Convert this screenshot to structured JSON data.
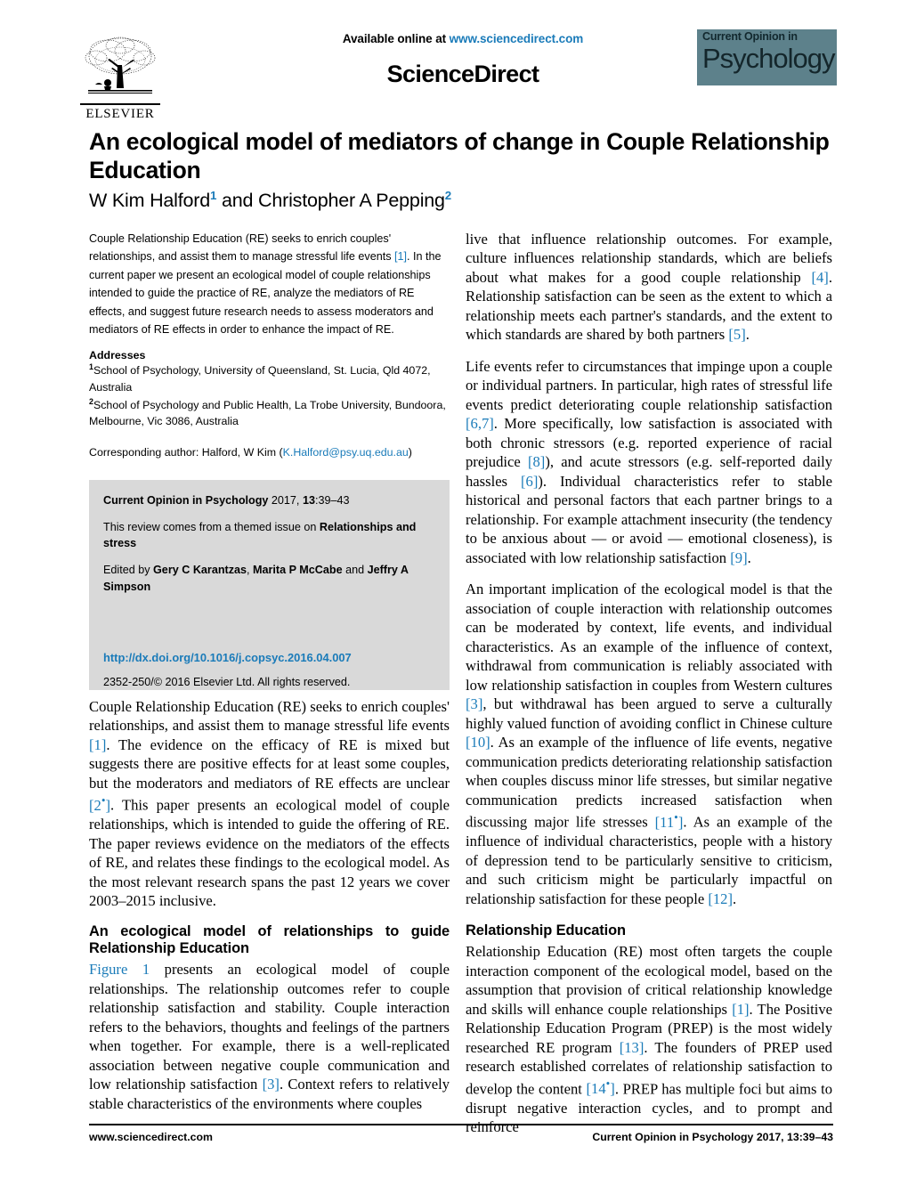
{
  "masthead": {
    "publisher_name": "ELSEVIER",
    "publisher_logo_icon": "elsevier-tree-icon",
    "available_prefix": "Available online at ",
    "available_url": "www.sciencedirect.com",
    "sciencedirect_wordmark": "ScienceDirect",
    "journal_logo_line1": "Current Opinion in",
    "journal_logo_line2": "Psychology",
    "journal_logo_bg": "#5d818b"
  },
  "article": {
    "title": "An ecological model of mediators of change in Couple Relationship Education",
    "authors_part1": "W Kim Halford",
    "author1_sup": "1",
    "authors_conjunction": " and ",
    "authors_part2": "Christopher A Pepping",
    "author2_sup": "2"
  },
  "abstract": {
    "text_a": "Couple Relationship Education (RE) seeks to enrich couples' relationships, and assist them to manage stressful life events ",
    "ref1": "[1]",
    "text_b": ". In the current paper we present an ecological model of couple relationships intended to guide the practice of RE, analyze the mediators of RE effects, and suggest future research needs to assess moderators and mediators of RE effects in order to enhance the impact of RE."
  },
  "addresses": {
    "heading": "Addresses",
    "items": [
      {
        "sup": "1",
        "text": "School of Psychology, University of Queensland, St. Lucia, Qld 4072, Australia"
      },
      {
        "sup": "2",
        "text": "School of Psychology and Public Health, La Trobe University, Bundoora, Melbourne, Vic 3086, Australia"
      }
    ],
    "corresponding_prefix": "Corresponding author: Halford, W Kim (",
    "corresponding_email": "K.Halford@psy.uq.edu.au",
    "corresponding_suffix": ")"
  },
  "journal_box": {
    "citation_bold": "Current Opinion in Psychology",
    "citation_rest": " 2017, ",
    "citation_volume": "13",
    "citation_pages": ":39–43",
    "themed_prefix": "This review comes from a themed issue on ",
    "themed_bold": "Relationships and stress",
    "edited_prefix": "Edited by ",
    "editor1": "Gery C Karantzas",
    "edited_sep1": ", ",
    "editor2": "Marita P McCabe",
    "edited_sep2": " and ",
    "editor3": "Jeffry A Simpson",
    "doi": "http://dx.doi.org/10.1016/j.copsyc.2016.04.007",
    "copyright": "2352-250/© 2016 Elsevier Ltd. All rights reserved.",
    "bg_color": "#d9d9d9",
    "link_color": "#1a7bb9"
  },
  "body": {
    "left": {
      "para1_a": "Couple Relationship Education (RE) seeks to enrich couples' relationships, and assist them to manage stressful life events ",
      "para1_ref1": "[1]",
      "para1_b": ". The evidence on the efficacy of RE is mixed but suggests there are positive effects for at least some couples, but the moderators and mediators of RE effects are unclear ",
      "para1_ref2": "[2",
      "para1_ref2_star": "•",
      "para1_ref2_close": "]",
      "para1_c": ". This paper presents an ecological model of couple relationships, which is intended to guide the offering of RE. The paper reviews evidence on the mediators of the effects of RE, and relates these findings to the ecological model. As the most relevant research spans the past 12 years we cover 2003–2015 inclusive.",
      "heading1": "An ecological model of relationships to guide Relationship Education",
      "para2_figlink": "Figure 1",
      "para2_a": " presents an ecological model of couple relationships. The relationship outcomes refer to couple relationship satisfaction and stability. Couple interaction refers to the behaviors, thoughts and feelings of the partners when together. For example, there is a well-replicated association between negative couple communication and low relationship satisfaction ",
      "para2_ref": "[3]",
      "para2_b": ". Context refers to relatively stable characteristics of the environments where couples"
    },
    "right": {
      "para1_a": "live that influence relationship outcomes. For example, culture influences relationship standards, which are beliefs about what makes for a good couple relationship ",
      "para1_ref4": "[4]",
      "para1_b": ". Relationship satisfaction can be seen as the extent to which a relationship meets each partner's standards, and the extent to which standards are shared by both partners ",
      "para1_ref5": "[5]",
      "para1_c": ".",
      "para2_a": "Life events refer to circumstances that impinge upon a couple or individual partners. In particular, high rates of stressful life events predict deteriorating couple relationship satisfaction ",
      "para2_ref67": "[6,7]",
      "para2_b": ". More specifically, low satisfaction is associated with both chronic stressors (e.g. reported experience of racial prejudice ",
      "para2_ref8": "[8]",
      "para2_c": "), and acute stressors (e.g. self-reported daily hassles ",
      "para2_ref6": "[6]",
      "para2_d": "). Individual characteristics refer to stable historical and personal factors that each partner brings to a relationship. For example attachment insecurity (the tendency to be anxious about — or avoid — emotional closeness), is associated with low relationship satisfaction ",
      "para2_ref9": "[9]",
      "para2_e": ".",
      "para3_a": "An important implication of the ecological model is that the association of couple interaction with relationship outcomes can be moderated by context, life events, and individual characteristics. As an example of the influence of context, withdrawal from communication is reliably associated with low relationship satisfaction in couples from Western cultures ",
      "para3_ref3": "[3]",
      "para3_b": ", but withdrawal has been argued to serve a culturally highly valued function of avoiding conflict in Chinese culture ",
      "para3_ref10": "[10]",
      "para3_c": ". As an example of the influence of life events, negative communication predicts deteriorating relationship satisfaction when couples discuss minor life stresses, but similar negative communication predicts increased satisfaction when discussing major life stresses ",
      "para3_ref11": "[11",
      "para3_ref11_star": "•",
      "para3_ref11_close": "]",
      "para3_d": ". As an example of the influence of individual characteristics, people with a history of depression tend to be particularly sensitive to criticism, and such criticism might be particularly impactful on relationship satisfaction for these people ",
      "para3_ref12": "[12]",
      "para3_e": ".",
      "heading1": "Relationship Education",
      "para4_a": "Relationship Education (RE) most often targets the couple interaction component of the ecological model, based on the assumption that provision of critical relationship knowledge and skills will enhance couple relationships ",
      "para4_ref1": "[1]",
      "para4_b": ". The Positive Relationship Education Program (PREP) is the most widely researched RE program ",
      "para4_ref13": "[13]",
      "para4_c": ". The founders of PREP used research established correlates of relationship satisfaction to develop the content ",
      "para4_ref14": "[14",
      "para4_ref14_star": "•",
      "para4_ref14_close": "]",
      "para4_d": ". PREP has multiple foci but aims to disrupt negative interaction cycles, and to prompt and reinforce"
    }
  },
  "footer": {
    "left": "www.sciencedirect.com",
    "right_bold": "Current Opinion in Psychology",
    "right_rest": " 2017, ",
    "right_volume": "13",
    "right_pages": ":39–43"
  }
}
